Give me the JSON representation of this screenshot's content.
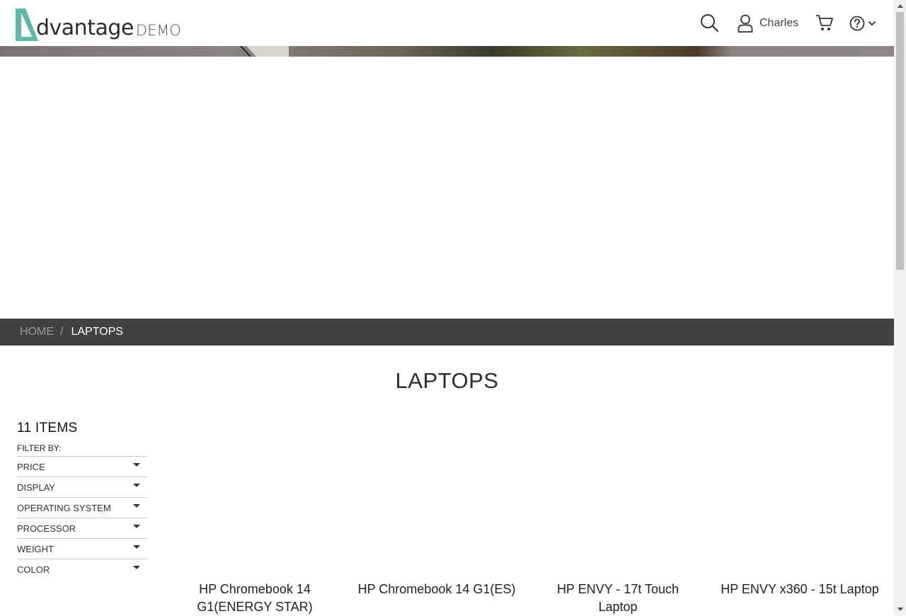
{
  "header": {
    "logo_word": "dvantage",
    "logo_demo": "DEMO",
    "user_name": "Charles",
    "brand_color": "#5fb7a7"
  },
  "breadcrumb": {
    "home": "HOME",
    "separator": "/",
    "current": "LAPTOPS"
  },
  "page_title": "LAPTOPS",
  "filters": {
    "items_count": "11 ITEMS",
    "filter_by": "FILTER BY:",
    "options": [
      "PRICE",
      "DISPLAY",
      "OPERATING SYSTEM",
      "PROCESSOR",
      "WEIGHT",
      "COLOR"
    ]
  },
  "products": [
    {
      "name": "HP Chromebook 14 G1(ENERGY STAR)"
    },
    {
      "name": "HP Chromebook 14 G1(ES)"
    },
    {
      "name": "HP ENVY - 17t Touch Laptop"
    },
    {
      "name": "HP ENVY x360 - 15t Laptop"
    }
  ],
  "icons": {
    "search": "search-icon",
    "user": "user-icon",
    "cart": "cart-icon",
    "help": "help-icon",
    "chevron": "chevron-down-icon"
  }
}
